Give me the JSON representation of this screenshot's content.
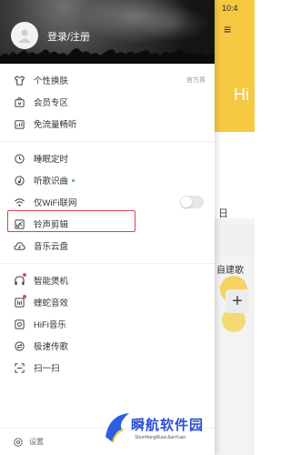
{
  "background": {
    "clock": "10:4",
    "menu_glyph": "≡",
    "greeting": "Hi",
    "recent_label": "日",
    "build_playlist": "自建歌",
    "add_glyph": "+"
  },
  "drawer": {
    "login_text": "登录/注册",
    "items": [
      {
        "label": "个性换肤",
        "right": "官方男"
      },
      {
        "label": "会员专区"
      },
      {
        "label": "免流量畅听"
      },
      {
        "label": "睡眠定时"
      },
      {
        "label": "听歌识曲"
      },
      {
        "label": "仅WiFi联网"
      },
      {
        "label": "铃声剪辑"
      },
      {
        "label": "音乐云盘"
      },
      {
        "label": "智能煲机"
      },
      {
        "label": "蝰蛇音效"
      },
      {
        "label": "HiFi音乐"
      },
      {
        "label": "极速传歌"
      },
      {
        "label": "扫一扫"
      }
    ],
    "footer_label": "设置",
    "colors": {
      "highlight_border": "#e0404a",
      "badge_red": "#e84a4a",
      "badge_green": "#47c14f"
    }
  },
  "watermark": {
    "title": "瞬航软件园",
    "subtitle": "ShunHangRuanJianYuan"
  }
}
